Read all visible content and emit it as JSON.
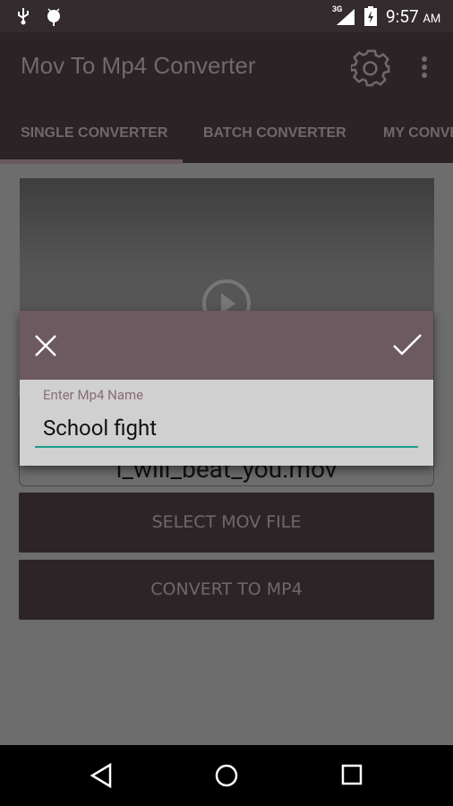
{
  "status_bar": {
    "time": "9:57",
    "ampm": "AM",
    "network": "3G",
    "icons": [
      "usb-icon",
      "android-debug-icon",
      "signal-icon",
      "battery-charging-icon"
    ]
  },
  "app_bar": {
    "title": "Mov To Mp4 Converter",
    "icons": [
      "gear-icon",
      "overflow-menu-icon"
    ]
  },
  "tabs": [
    {
      "label": "SINGLE CONVERTER",
      "selected": true
    },
    {
      "label": "BATCH CONVERTER",
      "selected": false
    },
    {
      "label": "MY CONVERSIONS",
      "selected": false
    }
  ],
  "main": {
    "file_name": "i_will_beat_you.mov",
    "select_button": "SELECT MOV FILE",
    "convert_button": "CONVERT TO MP4"
  },
  "dialog": {
    "label": "Enter Mp4 Name",
    "value": "School fight",
    "accent": "#1c9b8e",
    "header_color": "#6d5a60"
  },
  "nav_bar": {
    "icons": [
      "back-icon",
      "home-icon",
      "recents-icon"
    ]
  }
}
